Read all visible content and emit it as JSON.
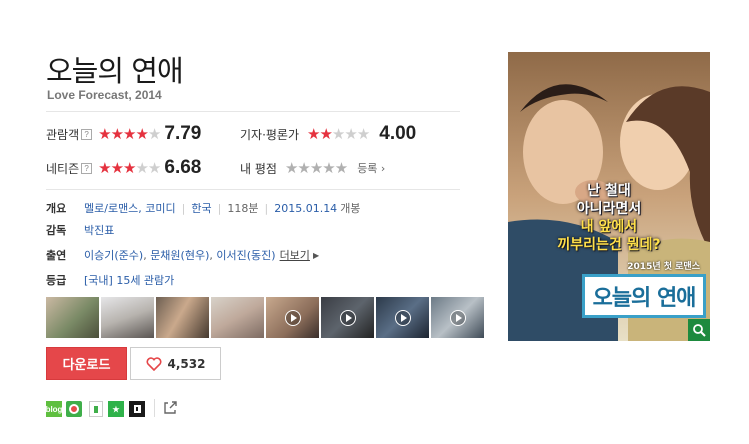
{
  "movie": {
    "title": "오늘의 연애",
    "subtitle": "Love Forecast, 2014"
  },
  "ratings": {
    "audience": {
      "label": "관람객",
      "score": "7.79",
      "stars": 4
    },
    "critics": {
      "label": "기자·평론가",
      "score": "4.00",
      "stars": 2
    },
    "netizen": {
      "label": "네티즌",
      "score": "6.68",
      "stars": 3.5
    },
    "mine": {
      "label": "내 평점",
      "register_label": "등록"
    }
  },
  "info": {
    "overview": {
      "label": "개요",
      "genre": "멜로/로맨스, 코미디",
      "country": "한국",
      "runtime": "118분",
      "release_date": "2015.01.14",
      "release_suffix": "개봉"
    },
    "director": {
      "label": "감독",
      "name": "박진표"
    },
    "cast": {
      "label": "출연",
      "actors": [
        "이승기(준수)",
        "문채원(현우)",
        "이서진(동진)"
      ],
      "more_label": "더보기"
    },
    "rating_grade": {
      "label": "등급",
      "value": "[국내] 15세 관람가"
    }
  },
  "actions": {
    "download_label": "다운로드",
    "like_count": "4,532"
  },
  "share": {
    "blog_label": "blog"
  },
  "poster": {
    "tagline_lines": [
      "난 철대",
      "아니라면서",
      "내 앞에서",
      "끼부리는건 뭔데?"
    ],
    "release_note": "2015년 첫 로맨스",
    "title": "오늘의 연애"
  }
}
